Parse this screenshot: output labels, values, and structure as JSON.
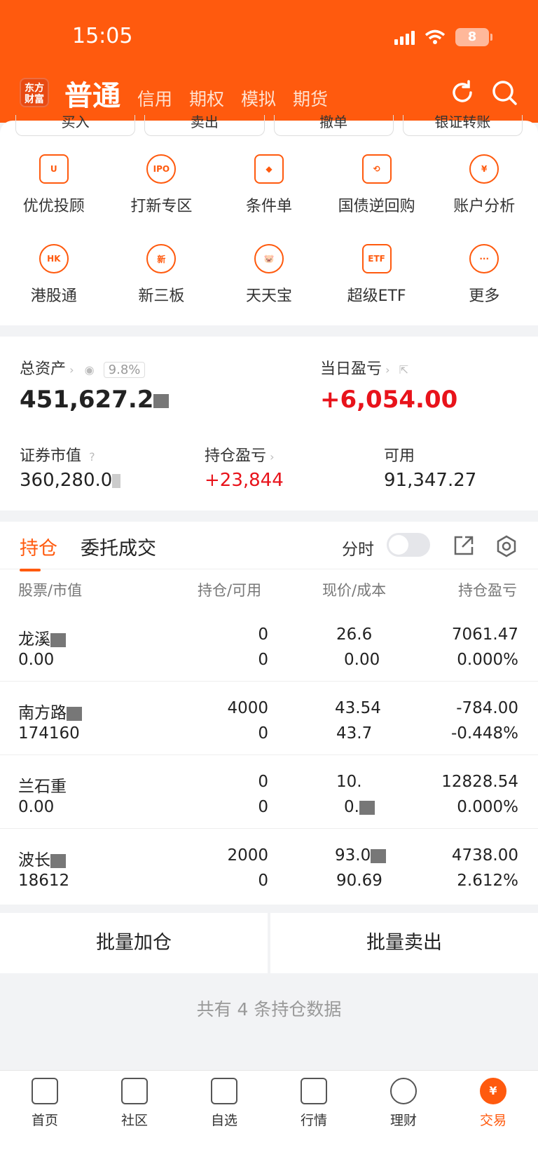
{
  "status": {
    "time": "15:05",
    "battery": "8"
  },
  "header": {
    "logo": "东方\n财富",
    "tab_main": "普通",
    "tabs": [
      "信用",
      "期权",
      "模拟",
      "期货"
    ]
  },
  "quick_actions": [
    "买入",
    "卖出",
    "撤单",
    "银证转账"
  ],
  "grid": [
    {
      "label": "优优投顾",
      "icon": "U"
    },
    {
      "label": "打新专区",
      "icon": "IPO"
    },
    {
      "label": "条件单",
      "icon": "◆"
    },
    {
      "label": "国债逆回购",
      "icon": "⟲"
    },
    {
      "label": "账户分析",
      "icon": "¥"
    },
    {
      "label": "港股通",
      "icon": "HK"
    },
    {
      "label": "新三板",
      "icon": "新"
    },
    {
      "label": "天天宝",
      "icon": "🐷"
    },
    {
      "label": "超级ETF",
      "icon": "ETF"
    },
    {
      "label": "更多",
      "icon": "···"
    }
  ],
  "assets": {
    "total_label": "总资产",
    "total_value": "451,627.2",
    "total_pct": "9.8%",
    "daily_label": "当日盈亏",
    "daily_value": "+6,054.00",
    "market_label": "证券市值",
    "market_value": "360,280.0",
    "hold_pl_label": "持仓盈亏",
    "hold_pl_value": "+23,844",
    "avail_label": "可用",
    "avail_value": "91,347.27"
  },
  "positions": {
    "tab_active": "持仓",
    "tab_other": "委托成交",
    "toggle_label": "分时",
    "headers": {
      "stock": "股票/市值",
      "hold": "持仓/可用",
      "price": "现价/成本",
      "pl": "持仓盈亏"
    },
    "rows": [
      {
        "name": "龙溪",
        "value": "0.00",
        "hold": "0",
        "avail": "0",
        "price": "26.6",
        "cost": "0.00",
        "pl": "7061.47",
        "pl_pct": "0.000%",
        "tone": "red"
      },
      {
        "name": "南方路",
        "value": "174160",
        "hold": "4000",
        "avail": "0",
        "price": "43.54",
        "cost": "43.7",
        "pl": "-784.00",
        "pl_pct": "-0.448%",
        "tone": "green"
      },
      {
        "name": "兰石重",
        "value": "0.00",
        "hold": "0",
        "avail": "0",
        "price": "10.",
        "cost": "0.",
        "pl": "12828.54",
        "pl_pct": "0.000%",
        "tone": "red"
      },
      {
        "name": "波长",
        "value": "18612",
        "hold": "2000",
        "avail": "0",
        "price": "93.0",
        "cost": "90.69",
        "pl": "4738.00",
        "pl_pct": "2.612%",
        "tone": "red"
      }
    ]
  },
  "bulk": {
    "add": "批量加仓",
    "sell": "批量卖出"
  },
  "footer_note": "共有 4 条持仓数据",
  "nav": [
    {
      "label": "首页"
    },
    {
      "label": "社区"
    },
    {
      "label": "自选"
    },
    {
      "label": "行情"
    },
    {
      "label": "理财"
    },
    {
      "label": "交易",
      "icon": "¥"
    }
  ]
}
